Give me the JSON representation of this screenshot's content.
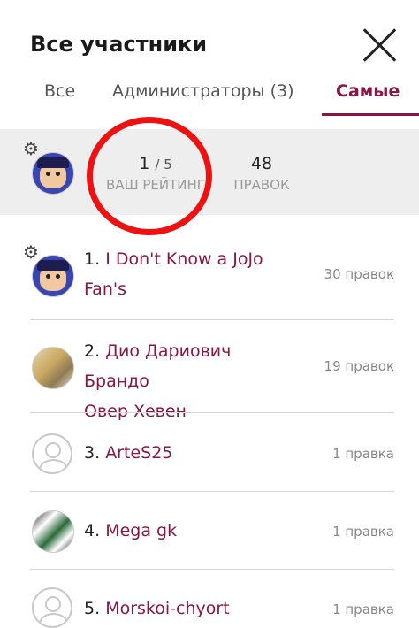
{
  "header": {
    "title": "Все участники"
  },
  "tabs": [
    {
      "label": "Все"
    },
    {
      "label": "Администраторы (3)"
    },
    {
      "label": "Самые"
    }
  ],
  "summary": {
    "rank": "1",
    "rank_total": "/ 5",
    "rank_label": "ВАШ РЕЙТИНГ",
    "edits": "48",
    "edits_label": "ПРАВОК"
  },
  "members": [
    {
      "position": "1.",
      "name_line1": "I Don't Know a JoJo",
      "name_line2": "Fan's",
      "edits": "30 правок"
    },
    {
      "position": "2.",
      "name_line1": "Дио Дариович Брандо",
      "name_line2": "Овер Хевен",
      "edits": "19 правок"
    },
    {
      "position": "3.",
      "name_line1": "ArteS25",
      "edits": "1 правка"
    },
    {
      "position": "4.",
      "name_line1": "Mega gk",
      "edits": "1 правка"
    },
    {
      "position": "5.",
      "name_line1": "Morskoi-chyort",
      "edits": "1 правка"
    }
  ],
  "colors": {
    "accent": "#8a1646",
    "highlight_circle": "#ee1111",
    "summary_bg": "#eeeeef"
  }
}
